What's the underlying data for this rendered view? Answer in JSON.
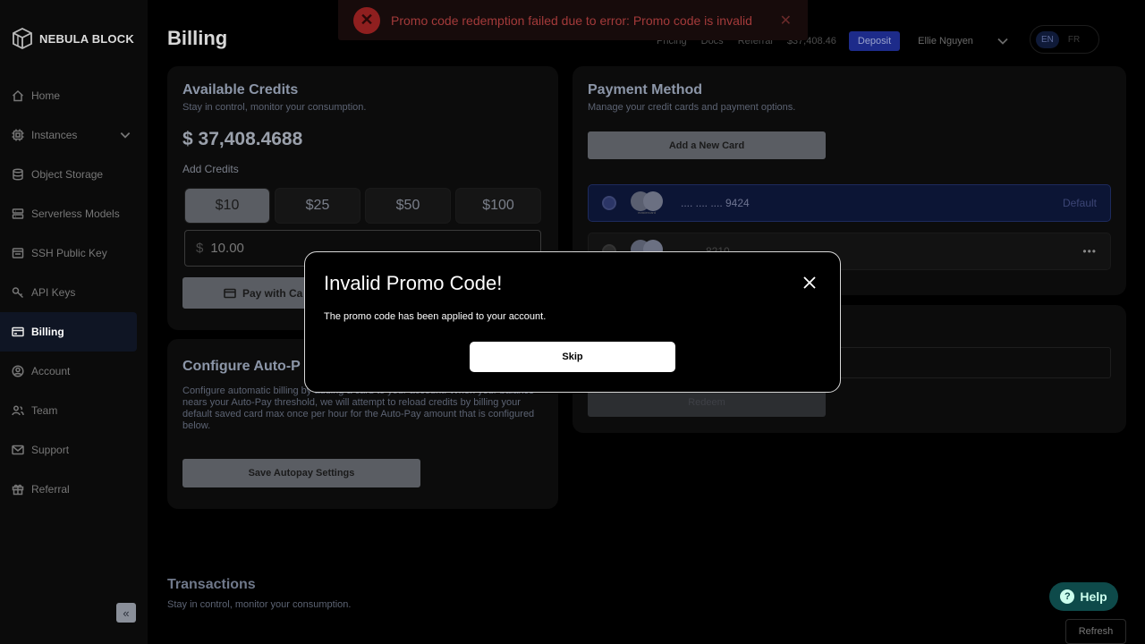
{
  "brand": {
    "name": "NEBULA BLOCK"
  },
  "sidebar": {
    "items": [
      {
        "label": "Home",
        "icon": "home-icon"
      },
      {
        "label": "Instances",
        "icon": "cpu-icon"
      },
      {
        "label": "Object Storage",
        "icon": "database-icon"
      },
      {
        "label": "Serverless Models",
        "icon": "server-icon"
      },
      {
        "label": "SSH Public Key",
        "icon": "terminal-icon"
      },
      {
        "label": "API Keys",
        "icon": "key-icon"
      },
      {
        "label": "Billing",
        "icon": "credit-card-icon",
        "active": true
      },
      {
        "label": "Account",
        "icon": "user-circle-icon"
      },
      {
        "label": "Team",
        "icon": "team-icon"
      },
      {
        "label": "Support",
        "icon": "mail-icon"
      },
      {
        "label": "Referral",
        "icon": "gift-icon"
      }
    ],
    "collapse_glyph": "«"
  },
  "header": {
    "title": "Billing",
    "links": [
      "Pricing",
      "Docs",
      "Referral"
    ],
    "balance": "$37,408.46",
    "deposit_label": "Deposit",
    "user_name": "Ellie Nguyen",
    "lang_en": "EN",
    "lang_fr": "FR"
  },
  "credits": {
    "title": "Available Credits",
    "subtitle": "Stay in control, monitor your consumption.",
    "amount": "$ 37,408.4688",
    "add_label": "Add Credits",
    "options": [
      "$10",
      "$25",
      "$50",
      "$100"
    ],
    "selected_index": 0,
    "currency_symbol": "$",
    "input_value": "10.00",
    "pay_label": "Pay with Ca"
  },
  "autopay": {
    "title": "Configure Auto-P",
    "description": "Configure automatic billing by adding a card to your account. When your balance nears your Auto-Pay threshold, we will attempt to reload credits by billing your default saved card max once per hour for the Auto-Pay amount that is configured below.",
    "save_label": "Save Autopay Settings"
  },
  "payment": {
    "title": "Payment Method",
    "subtitle": "Manage your credit cards and payment options.",
    "add_card_label": "Add a New Card",
    "cards": [
      {
        "number": ".... .... .... 9424",
        "brand": "mastercard",
        "default_label": "Default"
      },
      {
        "number": "8210",
        "brand": "mastercard",
        "more": "•••"
      }
    ]
  },
  "promo": {
    "redeem_label": "Redeem"
  },
  "transactions": {
    "title": "Transactions",
    "subtitle": "Stay in control, monitor your consumption.",
    "refresh_label": "Refresh"
  },
  "help": {
    "label": "Help",
    "glyph": "?"
  },
  "toast": {
    "message": "Promo code redemption failed due to error: Promo code is invalid",
    "error_glyph": "✕",
    "close_glyph": "✕"
  },
  "modal": {
    "title": "Invalid Promo Code!",
    "message": "The promo code has been applied to your account.",
    "skip_label": "Skip"
  }
}
